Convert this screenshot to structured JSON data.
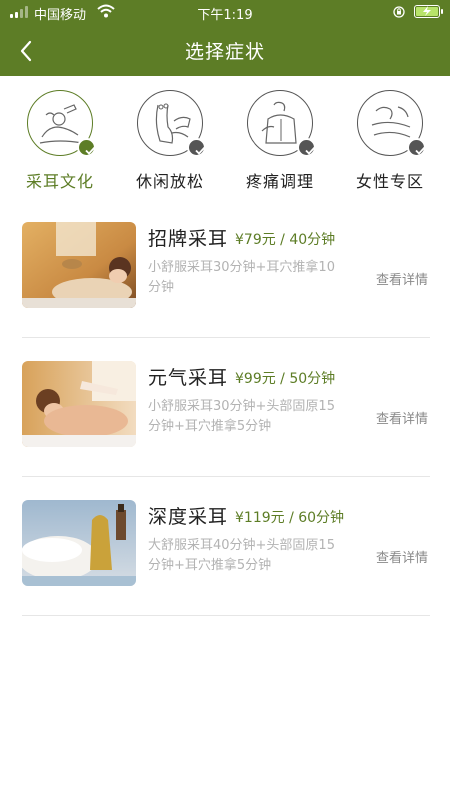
{
  "status_bar": {
    "carrier": "中国移动",
    "time": "下午1:19"
  },
  "header": {
    "title": "选择症状",
    "back_icon": "chevron-left-icon"
  },
  "categories": [
    {
      "label": "采耳文化",
      "icon": "ear-cleaning-icon",
      "active": true
    },
    {
      "label": "休闲放松",
      "icon": "foot-massage-icon",
      "active": false
    },
    {
      "label": "疼痛调理",
      "icon": "back-pain-icon",
      "active": false
    },
    {
      "label": "女性专区",
      "icon": "woman-massage-icon",
      "active": false
    }
  ],
  "services": [
    {
      "name": "招牌采耳",
      "price": "¥79元 / 40分钟",
      "desc": "小舒服采耳30分钟+耳穴推拿10分钟",
      "detail_label": "查看详情"
    },
    {
      "name": "元气采耳",
      "price": "¥99元 / 50分钟",
      "desc": "小舒服采耳30分钟+头部固原15分钟+耳穴推拿5分钟",
      "detail_label": "查看详情"
    },
    {
      "name": "深度采耳",
      "price": "¥119元 / 60分钟",
      "desc": "大舒服采耳40分钟+头部固原15分钟+耳穴推拿5分钟",
      "detail_label": "查看详情"
    }
  ],
  "colors": {
    "brand": "#5d7d26",
    "text": "#222222",
    "muted": "#b3b3b3"
  }
}
